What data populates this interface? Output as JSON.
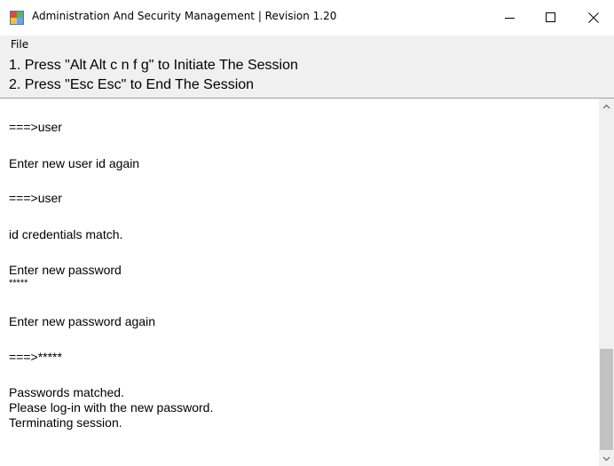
{
  "window": {
    "title": "Administration And Security Management  |  Revision 1.20"
  },
  "menu": {
    "file_label": "File"
  },
  "instructions": [
    "1. Press \"Alt Alt c n f g\" to Initiate The Session",
    "2. Press \"Esc Esc\" to End The Session"
  ],
  "console": {
    "lines": [
      "===>user",
      "Enter new user id again",
      "===>user",
      "id credentials match.",
      "Enter new password",
      "*****",
      "Enter new password again",
      "===>*****",
      "Passwords matched.",
      "Please log-in with the new password.",
      "Terminating session."
    ]
  },
  "colors": {
    "panel_background": "#f0f0f0",
    "scroll_thumb": "#c2c2c2"
  }
}
